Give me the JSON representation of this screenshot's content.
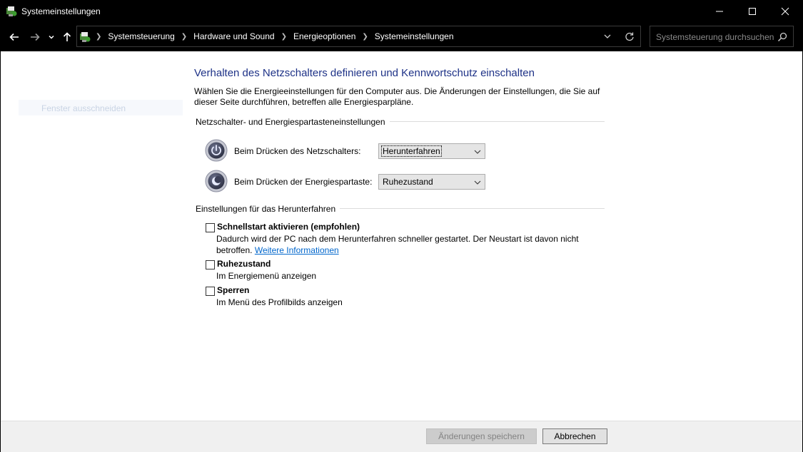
{
  "window": {
    "title": "Systemeinstellungen"
  },
  "nav": {
    "breadcrumbs": [
      "Systemsteuerung",
      "Hardware und Sound",
      "Energieoptionen",
      "Systemeinstellungen"
    ],
    "search_placeholder": "Systemsteuerung durchsuchen"
  },
  "sidebar": {
    "items": [
      {
        "label": "Fenster ausschneiden"
      }
    ]
  },
  "main": {
    "heading": "Verhalten des Netzschalters definieren und Kennwortschutz einschalten",
    "description": "Wählen Sie die Energieeinstellungen für den Computer aus. Die Änderungen der Einstellungen, die Sie auf dieser Seite durchführen, betreffen alle Energiesparpläne.",
    "power_group": {
      "label": "Netzschalter- und Energiespartasteneinstellungen",
      "rows": [
        {
          "label": "Beim Drücken des Netzschalters:",
          "value": "Herunterfahren",
          "icon": "power-button-icon"
        },
        {
          "label": "Beim Drücken der Energiespartaste:",
          "value": "Ruhezustand",
          "icon": "sleep-button-icon"
        }
      ]
    },
    "shutdown_group": {
      "label": "Einstellungen für das Herunterfahren",
      "options": [
        {
          "title": "Schnellstart aktivieren (empfohlen)",
          "desc": "Dadurch wird der PC nach dem Herunterfahren schneller gestartet. Der Neustart ist davon nicht betroffen.",
          "link": "Weitere Informationen",
          "checked": false
        },
        {
          "title": "Ruhezustand",
          "desc": "Im Energiemenü anzeigen",
          "checked": false
        },
        {
          "title": "Sperren",
          "desc": "Im Menü des Profilbilds anzeigen",
          "checked": false
        }
      ]
    }
  },
  "footer": {
    "save_label": "Änderungen speichern",
    "cancel_label": "Abbrechen"
  }
}
